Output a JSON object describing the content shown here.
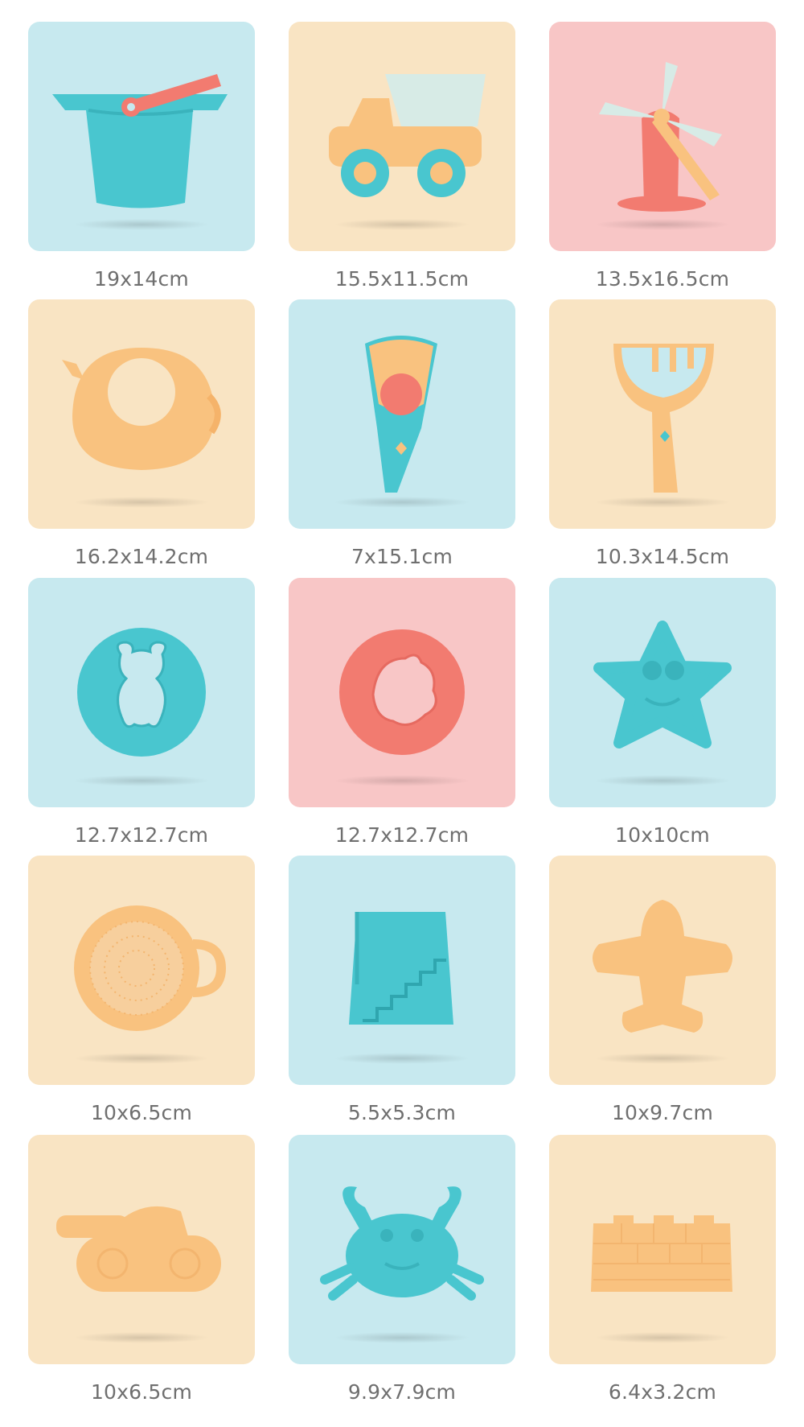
{
  "colors": {
    "blue_bg": "#c7e9ef",
    "yellow_bg": "#f9e4c3",
    "pink_bg": "#f8c6c6",
    "toy_teal": "#49c6cf",
    "toy_orange": "#f9c27f",
    "toy_coral": "#f27b70",
    "caption": "#6f6f6f"
  },
  "items": [
    {
      "icon": "bucket-icon",
      "bg": "blue",
      "size": "19x14cm"
    },
    {
      "icon": "dump-truck-icon",
      "bg": "yellow",
      "size": "15.5x11.5cm"
    },
    {
      "icon": "windmill-icon",
      "bg": "pink",
      "size": "13.5x16.5cm"
    },
    {
      "icon": "watering-can-icon",
      "bg": "yellow",
      "size": "16.2x14.2cm"
    },
    {
      "icon": "sieve-scoop-icon",
      "bg": "blue",
      "size": "7x15.1cm"
    },
    {
      "icon": "rake-spade-icon",
      "bg": "yellow",
      "size": "10.3x14.5cm"
    },
    {
      "icon": "bear-mold-icon",
      "bg": "blue",
      "size": "12.7x12.7cm"
    },
    {
      "icon": "fish-mold-icon",
      "bg": "pink",
      "size": "12.7x12.7cm"
    },
    {
      "icon": "starfish-mold-icon",
      "bg": "blue",
      "size": "10x10cm"
    },
    {
      "icon": "sieve-icon",
      "bg": "yellow",
      "size": "10x6.5cm"
    },
    {
      "icon": "stairs-mold-icon",
      "bg": "blue",
      "size": "5.5x5.3cm"
    },
    {
      "icon": "airplane-mold-icon",
      "bg": "yellow",
      "size": "10x9.7cm"
    },
    {
      "icon": "tank-mold-icon",
      "bg": "yellow",
      "size": "10x6.5cm"
    },
    {
      "icon": "crab-mold-icon",
      "bg": "blue",
      "size": "9.9x7.9cm"
    },
    {
      "icon": "castle-mold-icon",
      "bg": "yellow",
      "size": "6.4x3.2cm"
    }
  ]
}
